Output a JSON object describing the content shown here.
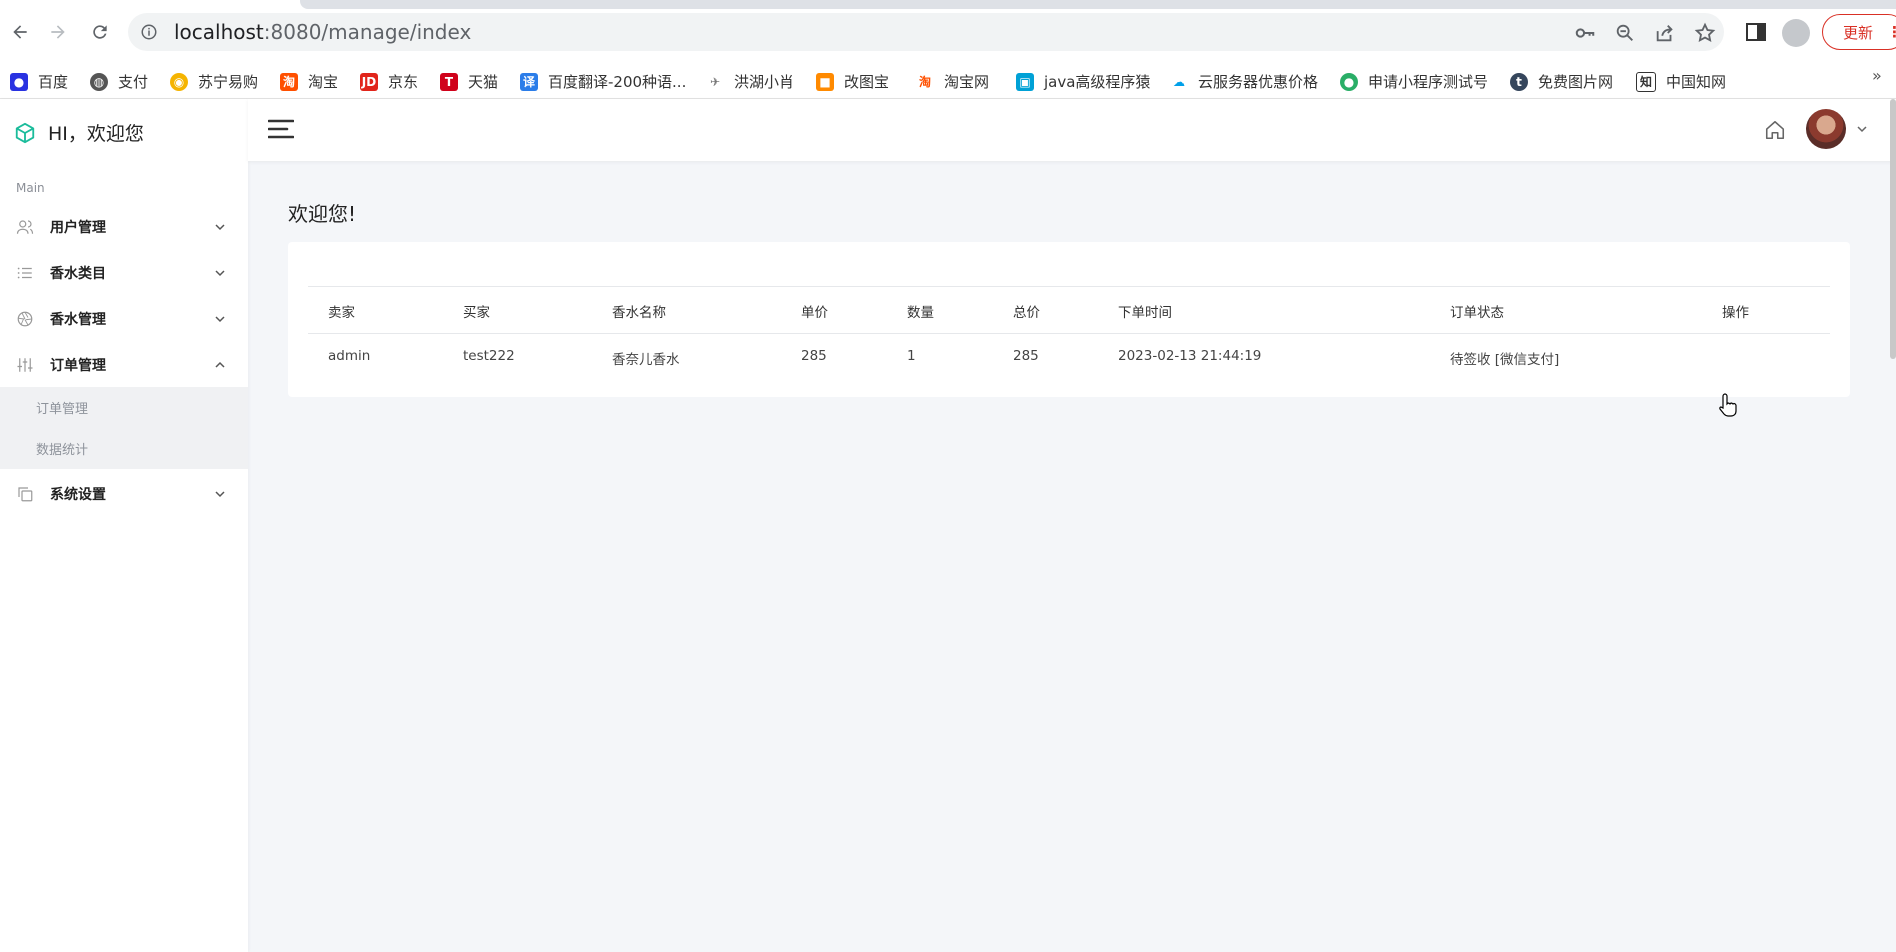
{
  "browser": {
    "url_host": "localhost",
    "url_rest": ":8080/manage/index",
    "update_label": "更新",
    "bookmarks": [
      {
        "label": "百度",
        "icon": "baidu-icon",
        "color": "#2932e1"
      },
      {
        "label": "支付",
        "icon": "globe-icon",
        "color": "#555555"
      },
      {
        "label": "苏宁易购",
        "icon": "suning-icon",
        "color": "#f5b400"
      },
      {
        "label": "淘宝",
        "icon": "taobao-icon",
        "color": "#ff5000"
      },
      {
        "label": "京东",
        "icon": "jd-icon",
        "color": "#e1251b"
      },
      {
        "label": "天猫",
        "icon": "tmall-icon",
        "color": "#d0021b"
      },
      {
        "label": "百度翻译-200种语...",
        "icon": "translate-icon",
        "color": "#2b7de9"
      },
      {
        "label": "洪湖小肖",
        "icon": "bird-icon",
        "color": "#777777"
      },
      {
        "label": "改图宝",
        "icon": "gaitubao-icon",
        "color": "#ff8a00"
      },
      {
        "label": "淘宝网",
        "icon": "taobao-icon",
        "color": "#ff5000"
      },
      {
        "label": "java高级程序猿",
        "icon": "bilibili-icon",
        "color": "#00a1d6"
      },
      {
        "label": "云服务器优惠价格",
        "icon": "cloud-icon",
        "color": "#00a0e9"
      },
      {
        "label": "申请小程序测试号",
        "icon": "wechat-icon",
        "color": "#2aae67"
      },
      {
        "label": "免费图片网",
        "icon": "tumblr-icon",
        "color": "#35465c"
      },
      {
        "label": "中国知网",
        "icon": "cnki-icon",
        "color": "#333333"
      }
    ]
  },
  "sidebar": {
    "brand": "HI，欢迎您",
    "section": "Main",
    "items": [
      {
        "label": "用户管理",
        "icon": "users-icon",
        "expanded": false
      },
      {
        "label": "香水类目",
        "icon": "list-icon",
        "expanded": false
      },
      {
        "label": "香水管理",
        "icon": "aperture-icon",
        "expanded": false
      },
      {
        "label": "订单管理",
        "icon": "sliders-icon",
        "expanded": true
      },
      {
        "label": "系统设置",
        "icon": "copy-icon",
        "expanded": false
      }
    ],
    "submenu": [
      "订单管理",
      "数据统计"
    ]
  },
  "main": {
    "title": "欢迎您!",
    "table": {
      "headers": [
        "卖家",
        "买家",
        "香水名称",
        "单价",
        "数量",
        "总价",
        "下单时间",
        "订单状态",
        "操作"
      ],
      "rows": [
        [
          "admin",
          "test222",
          "香奈儿香水",
          "285",
          "1",
          "285",
          "2023-02-13 21:44:19",
          "待签收 [微信支付]",
          ""
        ]
      ]
    }
  },
  "colors": {
    "accent": "#1bbc9b",
    "update": "#d93025",
    "background": "#f4f6f9"
  }
}
